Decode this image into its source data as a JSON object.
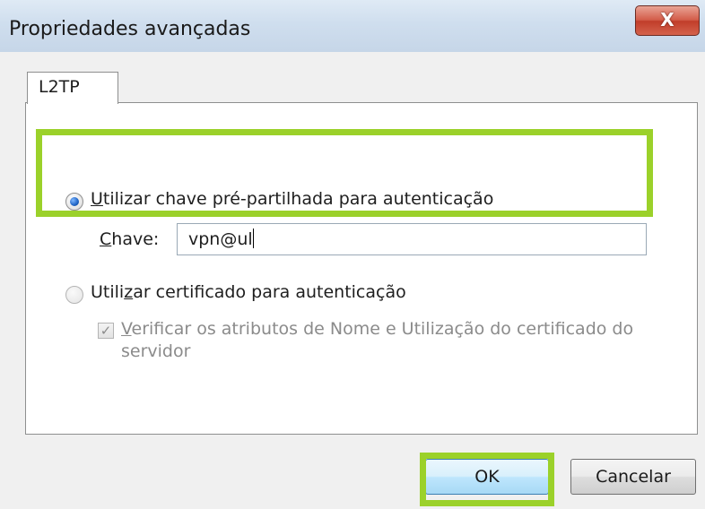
{
  "window": {
    "title": "Propriedades avançadas",
    "close_glyph": "X"
  },
  "tabs": [
    {
      "label": "L2TP",
      "selected": true
    }
  ],
  "preshared": {
    "radio_selected": true,
    "label_mnemonic": "U",
    "label_rest": "tilizar chave pré-partilhada para autenticação",
    "key_label_mnemonic": "C",
    "key_label_rest": "have:",
    "key_value": "vpn@ul"
  },
  "certificate": {
    "radio_selected": false,
    "label_pre": "Utili",
    "label_mnemonic": "z",
    "label_rest": "ar certificado para autenticação",
    "verify_checked": true,
    "verify_enabled": false,
    "verify_label_mnemonic": "V",
    "verify_label_line1_rest": "erificar os atributos de Nome e Utilização do certificado do",
    "verify_label_line2": "servidor"
  },
  "buttons": {
    "ok_label": "OK",
    "cancel_label": "Cancelar"
  },
  "colors": {
    "highlight": "#9bd12a",
    "close_red": "#c13d2a",
    "titlebar": "#cfdeee"
  }
}
